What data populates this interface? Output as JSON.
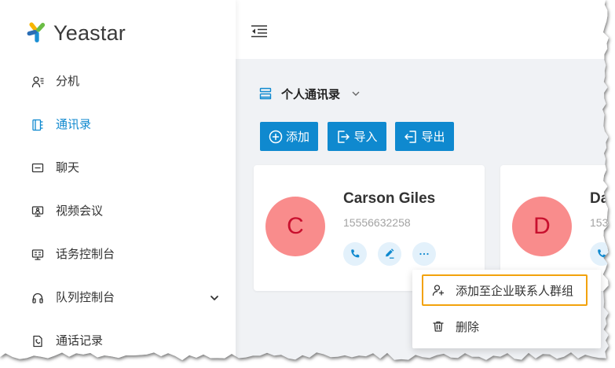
{
  "app": {
    "logo_text": "Yeastar",
    "logo_icon": "yeastar-logo-icon"
  },
  "colors": {
    "accent": "#0f89cf",
    "avatar_bg": "#f98c8c",
    "avatar_text": "#c8102e",
    "highlight_border": "#f2a20c",
    "content_bg": "#f0f2f5"
  },
  "sidebar": {
    "items": [
      {
        "label": "分机",
        "icon": "extension-icon",
        "active": false
      },
      {
        "label": "通讯录",
        "icon": "contacts-book-icon",
        "active": true
      },
      {
        "label": "聊天",
        "icon": "chat-icon",
        "active": false
      },
      {
        "label": "视频会议",
        "icon": "video-meeting-icon",
        "active": false
      },
      {
        "label": "话务控制台",
        "icon": "switchboard-icon",
        "active": false
      },
      {
        "label": "队列控制台",
        "icon": "headset-icon",
        "active": false,
        "expandable": true
      },
      {
        "label": "通话记录",
        "icon": "call-log-icon",
        "active": false
      }
    ]
  },
  "header": {
    "collapse_icon": "menu-fold-icon"
  },
  "toolbar": {
    "phonebook_selected": "个人通讯录",
    "add_label": "添加",
    "import_label": "导入",
    "export_label": "导出"
  },
  "contacts": [
    {
      "initial": "C",
      "name": "Carson Giles",
      "phone": "15556632258"
    },
    {
      "initial": "D",
      "name": "Da",
      "phone": "153"
    }
  ],
  "context_menu": {
    "items": [
      {
        "label": "添加至企业联系人群组",
        "icon": "add-user-icon",
        "highlighted": true
      },
      {
        "label": "删除",
        "icon": "trash-icon",
        "highlighted": false
      }
    ]
  }
}
